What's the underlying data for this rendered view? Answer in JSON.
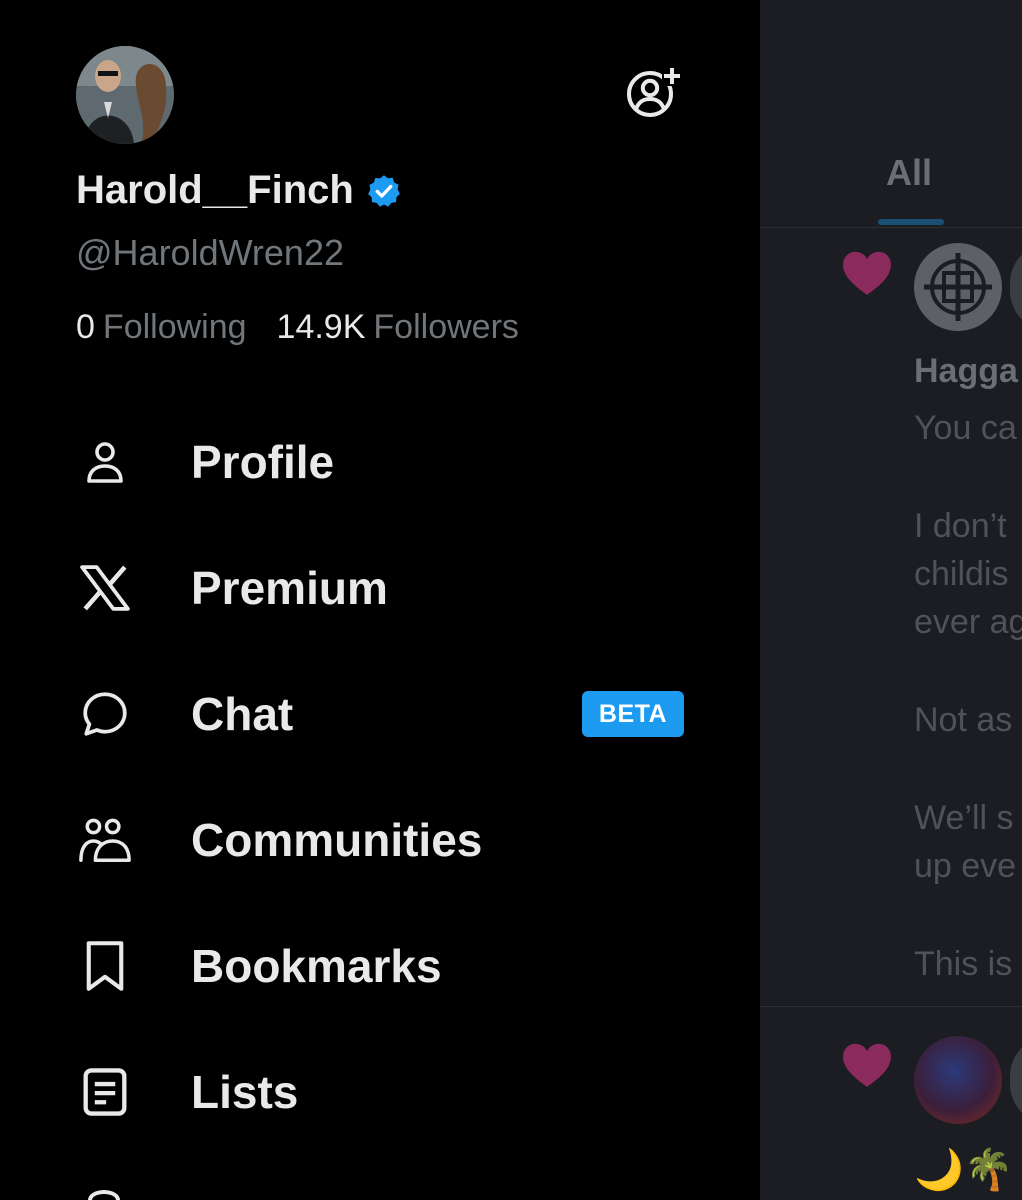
{
  "colors": {
    "accent": "#1d9bf0",
    "text_primary": "#e7e9ea",
    "text_secondary": "#71767b",
    "heart": "#8b2a5c",
    "drawer_bg": "#000000",
    "timeline_bg": "#1b1d22"
  },
  "profile": {
    "display_name": "Harold__Finch",
    "handle": "@HaroldWren22",
    "verified_icon": "verified-badge-icon",
    "following_count": "0",
    "following_label": "Following",
    "followers_count": "14.9K",
    "followers_label": "Followers",
    "add_account_icon": "add-account-icon"
  },
  "menu": {
    "items": [
      {
        "label": "Profile",
        "icon": "person-icon"
      },
      {
        "label": "Premium",
        "icon": "x-logo-icon"
      },
      {
        "label": "Chat",
        "icon": "chat-bubble-icon",
        "badge": "BETA"
      },
      {
        "label": "Communities",
        "icon": "communities-icon"
      },
      {
        "label": "Bookmarks",
        "icon": "bookmark-icon"
      },
      {
        "label": "Lists",
        "icon": "list-icon"
      }
    ]
  },
  "timeline": {
    "active_tab": "All",
    "notifications": [
      {
        "icon": "heart-icon",
        "name": "Hagga",
        "lines": [
          "You ca",
          "",
          "I don’t",
          "childis",
          "ever ag",
          "",
          "Not as",
          "",
          "We’ll s",
          "up eve",
          "",
          "This is"
        ]
      },
      {
        "icon": "heart-icon",
        "emoji": "🌙🌴"
      }
    ]
  }
}
